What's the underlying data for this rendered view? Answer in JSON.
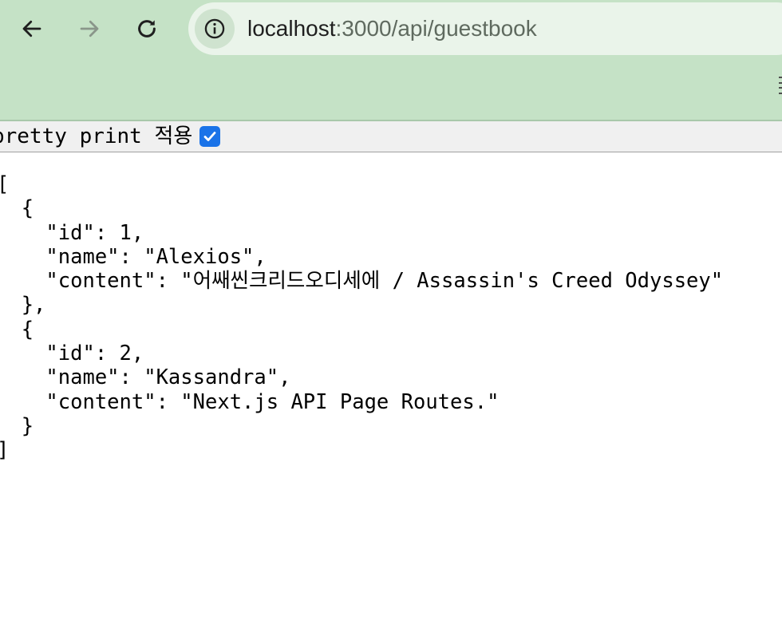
{
  "browser": {
    "url_host": "localhost",
    "url_rest": ":3000/api/guestbook",
    "icons": {
      "back": "arrow-left-icon",
      "forward": "arrow-right-icon",
      "reload": "reload-icon",
      "site_info": "info-circle-icon"
    },
    "colors": {
      "toolbar_bg": "#c5e2c6",
      "omnibox_bg": "#eaf4ea"
    }
  },
  "pretty_print": {
    "label": "pretty print 적용",
    "checked": true,
    "checkbox_color": "#1a73e8"
  },
  "json_lines": {
    "l01": "[",
    "l02": "  {",
    "l03": "    \"id\": 1,",
    "l04": "    \"name\": \"Alexios\",",
    "l05": "    \"content\": \"어쌔씬크리드오디세에 / Assassin's Creed Odyssey\"",
    "l06": "  },",
    "l07": "  {",
    "l08": "    \"id\": 2,",
    "l09": "    \"name\": \"Kassandra\",",
    "l10": "    \"content\": \"Next.js API Page Routes.\"",
    "l11": "  }",
    "l12": "]"
  }
}
